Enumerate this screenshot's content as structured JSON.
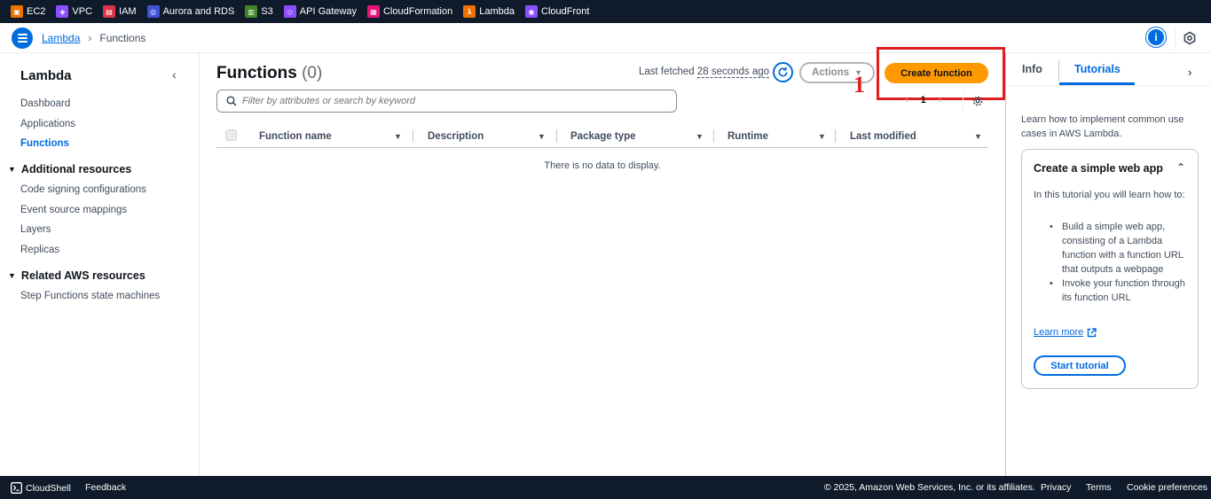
{
  "services": [
    {
      "label": "EC2",
      "color": "#ed7100",
      "glyph": "▣",
      "icon": "ec2-icon"
    },
    {
      "label": "VPC",
      "color": "#8c4fff",
      "glyph": "◈",
      "icon": "vpc-icon"
    },
    {
      "label": "IAM",
      "color": "#dd344c",
      "glyph": "▤",
      "icon": "iam-icon"
    },
    {
      "label": "Aurora and RDS",
      "color": "#4053d6",
      "glyph": "◎",
      "icon": "rds-icon"
    },
    {
      "label": "S3",
      "color": "#3f8624",
      "glyph": "▥",
      "icon": "s3-icon"
    },
    {
      "label": "API Gateway",
      "color": "#8c4fff",
      "glyph": "◇",
      "icon": "api-gateway-icon"
    },
    {
      "label": "CloudFormation",
      "color": "#e7157b",
      "glyph": "▦",
      "icon": "cloudformation-icon"
    },
    {
      "label": "Lambda",
      "color": "#ed7100",
      "glyph": "λ",
      "icon": "lambda-icon"
    },
    {
      "label": "CloudFront",
      "color": "#8c4fff",
      "glyph": "◉",
      "icon": "cloudfront-icon"
    }
  ],
  "breadcrumb": {
    "root": "Lambda",
    "current": "Functions"
  },
  "sidebar": {
    "title": "Lambda",
    "items": [
      "Dashboard",
      "Applications",
      "Functions"
    ],
    "active": "Functions",
    "sections": [
      {
        "title": "Additional resources",
        "items": [
          "Code signing configurations",
          "Event source mappings",
          "Layers",
          "Replicas"
        ]
      },
      {
        "title": "Related AWS resources",
        "items": [
          "Step Functions state machines"
        ]
      }
    ]
  },
  "main": {
    "title": "Functions",
    "count": "(0)",
    "last_fetched_prefix": "Last fetched",
    "last_fetched_value": "28 seconds ago",
    "actions_label": "Actions",
    "create_label": "Create function",
    "annotation_number": "1",
    "search_placeholder": "Filter by attributes or search by keyword",
    "page_number": "1",
    "columns": [
      "Function name",
      "Description",
      "Package type",
      "Runtime",
      "Last modified"
    ],
    "empty_text": "There is no data to display."
  },
  "help": {
    "tabs": [
      "Info",
      "Tutorials"
    ],
    "active_tab": "Tutorials",
    "intro": "Learn how to implement common use cases in AWS Lambda.",
    "card_title": "Create a simple web app",
    "card_desc": "In this tutorial you will learn how to:",
    "bullets": [
      "Build a simple web app, consisting of a Lambda function with a function URL that outputs a webpage",
      "Invoke your function through its function URL"
    ],
    "learn_more": "Learn more",
    "start_label": "Start tutorial"
  },
  "footer": {
    "cloudshell": "CloudShell",
    "feedback": "Feedback",
    "copyright": "© 2025, Amazon Web Services, Inc. or its affiliates.",
    "privacy": "Privacy",
    "terms": "Terms",
    "cookies": "Cookie preferences"
  }
}
